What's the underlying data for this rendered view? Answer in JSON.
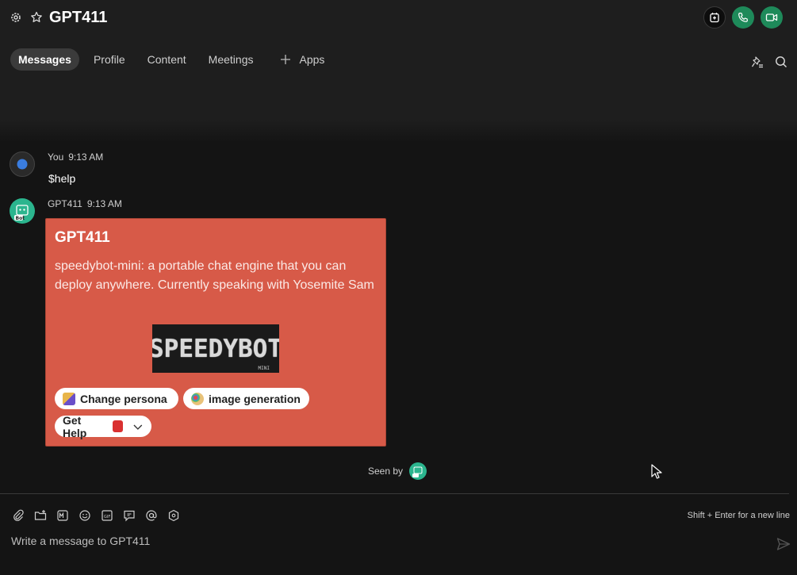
{
  "header": {
    "title": "GPT411",
    "settings_icon": "gear-icon",
    "favorite_icon": "star-icon",
    "actions": [
      {
        "icon": "add-to-calendar-icon"
      },
      {
        "icon": "phone-icon"
      },
      {
        "icon": "video-camera-icon"
      }
    ]
  },
  "tabs": {
    "messages": "Messages",
    "profile": "Profile",
    "content": "Content",
    "meetings": "Meetings",
    "apps": "Apps"
  },
  "toolbar_icons": [
    "pin-list-icon",
    "search-icon"
  ],
  "messages": [
    {
      "sender": "You",
      "time": "9:13 AM",
      "text": "$help"
    },
    {
      "sender": "GPT411",
      "time": "9:13 AM"
    }
  ],
  "card": {
    "title": "GPT411",
    "body": "speedybot-mini: a portable chat engine that you can deploy anywhere. Currently speaking with Yosemite Sam",
    "logo_text": "SPEEDYBOT",
    "logo_mini": "MINI",
    "buttons": {
      "change_persona": "Change persona",
      "image_generation": "image generation",
      "get_help": "Get Help"
    },
    "accent_color": "#d75a48"
  },
  "seen_by": {
    "label": "Seen by"
  },
  "composer": {
    "placeholder": "Write a message to GPT411",
    "hint": "Shift + Enter for a new line"
  },
  "colors": {
    "background": "#141414",
    "header": "#1e1e1e",
    "call_green": "#1e8a5a",
    "bot_avatar": "#2bb58e"
  }
}
